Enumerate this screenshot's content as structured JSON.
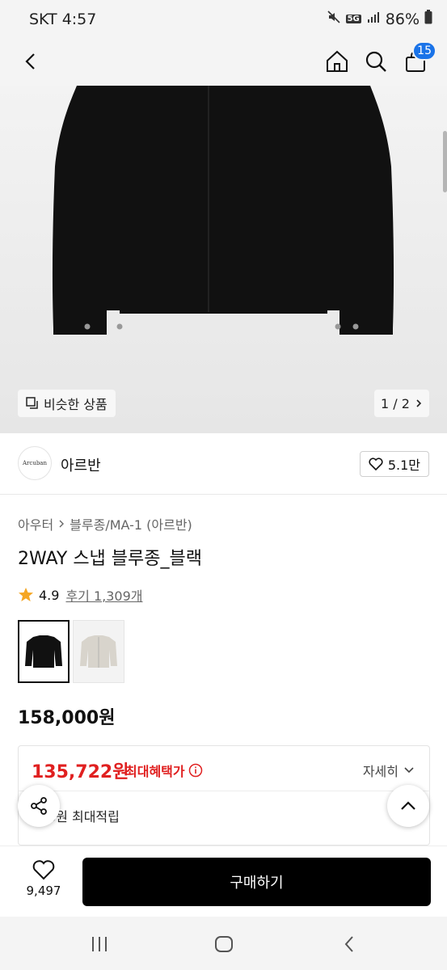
{
  "status_bar": {
    "carrier_time": "SKT 4:57",
    "network": "5G",
    "battery": "86%"
  },
  "header": {
    "cart_count": "15",
    "icons": [
      "back-icon",
      "home-icon",
      "search-icon",
      "cart-icon"
    ]
  },
  "hero": {
    "similar_label": "비슷한 상품",
    "pager": "1 / 2"
  },
  "brand": {
    "logo_text": "Arcuban",
    "name": "아르반",
    "likes": "5.1만"
  },
  "breadcrumb": {
    "level1": "아우터",
    "level2": "블루종/MA-1 (아르반)"
  },
  "product": {
    "title": "2WAY 스냅 블루종_블랙",
    "rating": "4.9",
    "reviews": "후기 1,309개",
    "price": "158,000원"
  },
  "colors": {
    "swatches": [
      "#111111",
      "#d8d4cc"
    ],
    "selected": 0
  },
  "benefit": {
    "max_price": "135,722원",
    "max_label": "최대혜택가",
    "detail_label": "자세히",
    "points_visible": "8원 최대적립"
  },
  "bottom": {
    "wish_count": "9,497",
    "buy_label": "구매하기"
  }
}
